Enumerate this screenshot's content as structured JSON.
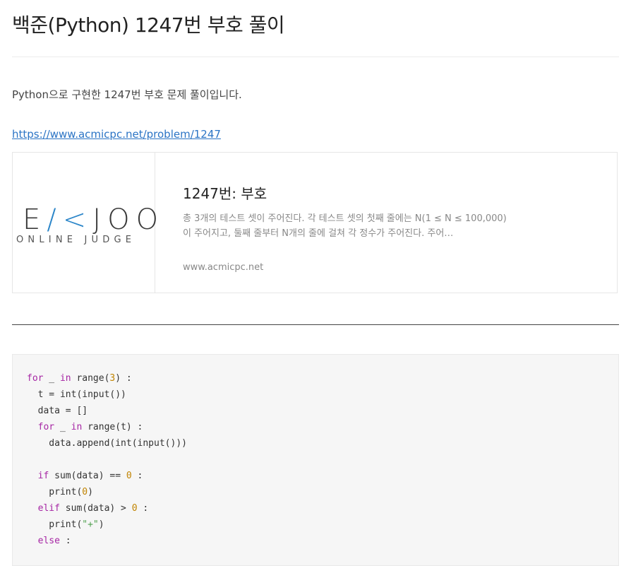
{
  "post": {
    "title": "백준(Python) 1247번 부호 풀이",
    "intro": "Python으로 구현한 1247번 부호 문제 풀이입니다.",
    "link": "https://www.acmicpc.net/problem/1247"
  },
  "link_card": {
    "logo_main_left": "E",
    "logo_main_accent": "/<",
    "logo_main_right": "JOO",
    "logo_sub": "ONLINE JUDGE",
    "title": "1247번: 부호",
    "description": "총 3개의 테스트 셋이 주어진다. 각 테스트 셋의 첫째 줄에는 N(1 ≤ N ≤ 100,000)이 주어지고, 둘째 줄부터 N개의 줄에 걸쳐 각 정수가 주어진다. 주어…",
    "domain": "www.acmicpc.net"
  },
  "code_tokens": {
    "kw_for": "for",
    "kw_in": "in",
    "kw_if": "if",
    "kw_elif": "elif",
    "kw_else": "else",
    "n3": "3",
    "n0": "0",
    "s_plus": "\"+\""
  },
  "colors": {
    "accent_link": "#2b74c5",
    "logo_accent": "#2c86c9",
    "keyword": "#a626a4",
    "number": "#c18401",
    "string": "#50a14f"
  }
}
